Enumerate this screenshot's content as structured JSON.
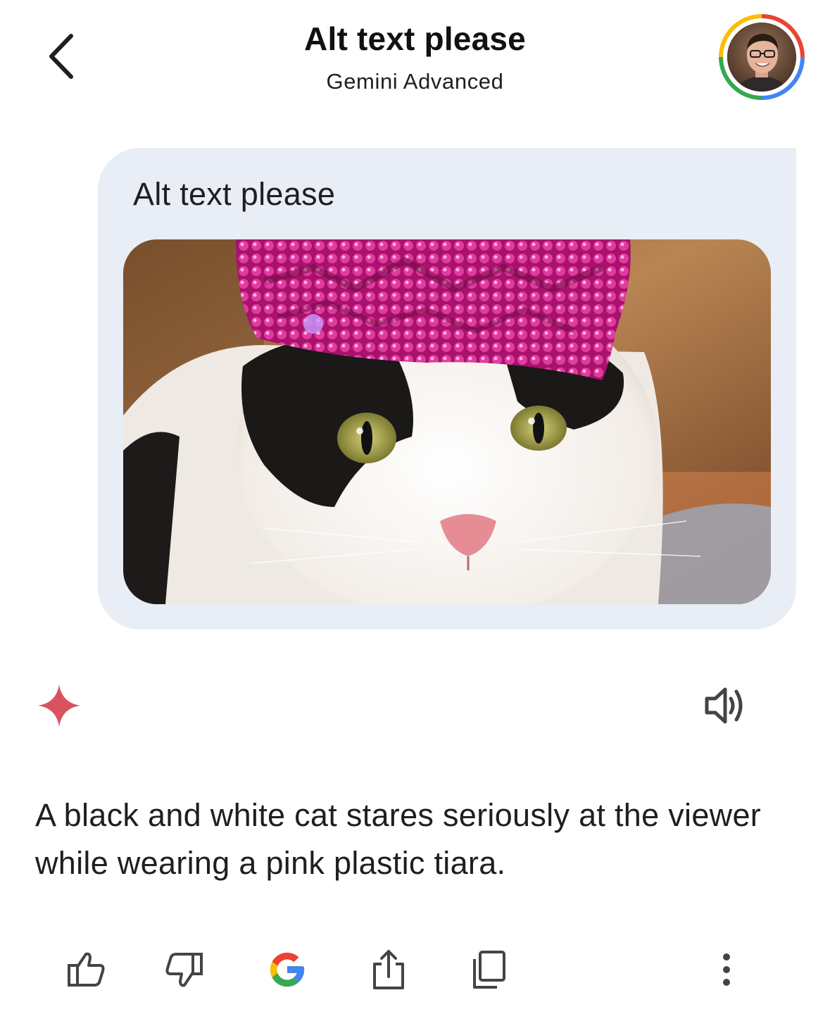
{
  "header": {
    "title": "Alt text please",
    "subtitle": "Gemini Advanced",
    "back_icon": "chevron-left-icon",
    "avatar_icon": "user-avatar"
  },
  "prompt": {
    "text": "Alt text please",
    "image_subject": "black and white cat wearing a pink plastic tiara"
  },
  "response": {
    "text": "A black and white cat stares seriously at the viewer while wearing a pink plastic tiara.",
    "logo_icon": "gemini-sparkle-icon",
    "speaker_icon": "speaker-icon"
  },
  "actions": [
    {
      "name": "thumbs-up",
      "icon": "thumbs-up-icon"
    },
    {
      "name": "thumbs-down",
      "icon": "thumbs-down-icon"
    },
    {
      "name": "google-it",
      "icon": "google-g-icon"
    },
    {
      "name": "share",
      "icon": "share-icon"
    },
    {
      "name": "copy",
      "icon": "copy-icon"
    },
    {
      "name": "more",
      "icon": "more-vertical-icon"
    }
  ],
  "colors": {
    "bubble_bg": "#e9edf5",
    "sparkle": "#d9535f",
    "text": "#1f1f1f",
    "google_blue": "#4285f4",
    "google_red": "#ea4335",
    "google_yellow": "#fbbc05",
    "google_green": "#34a853"
  }
}
